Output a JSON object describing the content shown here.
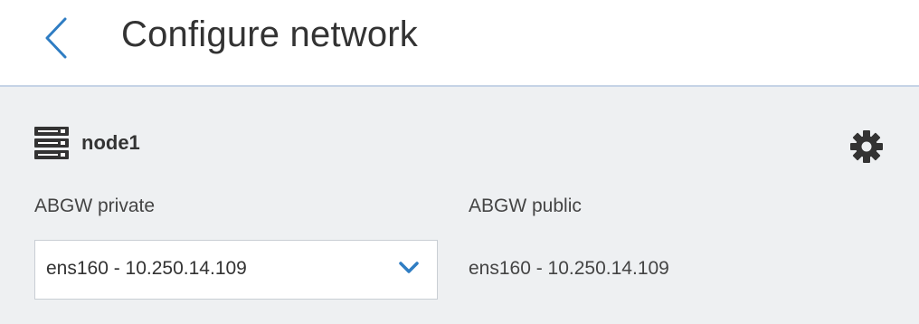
{
  "header": {
    "title": "Configure network",
    "back_icon": "chevron-left-icon"
  },
  "node": {
    "icon": "server-icon",
    "name": "node1",
    "settings_icon": "gear-icon"
  },
  "networks": {
    "private": {
      "label": "ABGW private",
      "selected": "ens160 - 10.250.14.109",
      "dropdown_icon": "chevron-down-icon"
    },
    "public": {
      "label": "ABGW public",
      "value": "ens160 - 10.250.14.109"
    }
  },
  "colors": {
    "accent": "#2f7dc3",
    "text": "#333333",
    "panel_bg": "#eef0f2",
    "divider": "#c5d3e6"
  }
}
